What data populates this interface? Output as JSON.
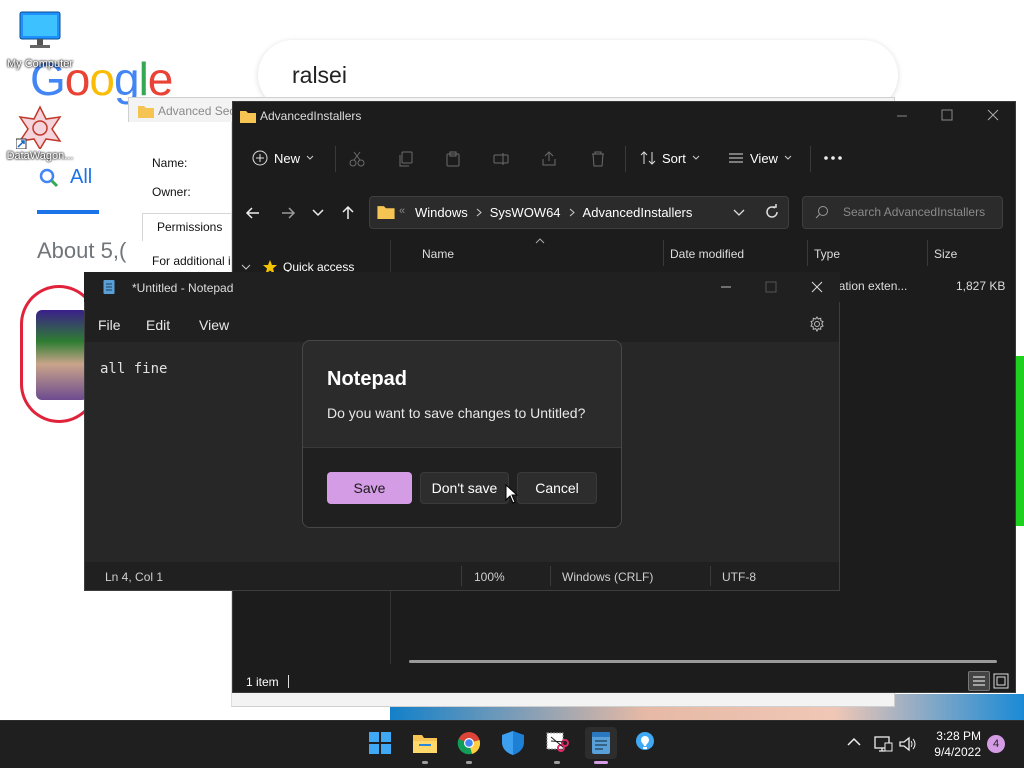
{
  "desktop": {
    "icons": [
      {
        "label": "My Computer"
      },
      {
        "label": "DataWagon..."
      }
    ]
  },
  "browser": {
    "logo": [
      "G",
      "o",
      "o",
      "g",
      "l",
      "e"
    ],
    "search_query": "ralsei",
    "tab_all": "All",
    "about_text": "About 5,("
  },
  "properties": {
    "title": "Advanced Sec",
    "name_label": "Name:",
    "owner_label": "Owner:",
    "tab_permissions": "Permissions",
    "additional": "For additional i"
  },
  "explorer": {
    "title": "AdvancedInstallers",
    "toolbar": {
      "new": "New",
      "sort": "Sort",
      "view": "View"
    },
    "breadcrumb": [
      "Windows",
      "SysWOW64",
      "AdvancedInstallers"
    ],
    "search_placeholder": "Search AdvancedInstallers",
    "nav": {
      "quick_access": "Quick access"
    },
    "columns": [
      "Name",
      "Date modified",
      "Type",
      "Size"
    ],
    "rows": [
      {
        "type": "ication exten...",
        "size": "1,827 KB"
      }
    ],
    "status": "1 item"
  },
  "notepad": {
    "title": "*Untitled - Notepad",
    "menu": [
      "File",
      "Edit",
      "View"
    ],
    "content": "all fine",
    "status": {
      "position": "Ln 4, Col 1",
      "zoom": "100%",
      "line_ending": "Windows (CRLF)",
      "encoding": "UTF-8"
    }
  },
  "dialog": {
    "title": "Notepad",
    "message": "Do you want to save changes to Untitled?",
    "save": "Save",
    "dont_save": "Don't save",
    "cancel": "Cancel"
  },
  "taskbar": {
    "apps": [
      "start-icon",
      "file-explorer-icon",
      "chrome-icon",
      "windows-security-icon",
      "snipping-tool-icon",
      "notepad-icon",
      "tips-icon"
    ],
    "time": "3:28 PM",
    "date": "9/4/2022",
    "notification_count": "4"
  },
  "colors": {
    "accent": "#d59ce6",
    "taskbar": "#1f1f1f",
    "window_dark": "#1c1c1c"
  }
}
